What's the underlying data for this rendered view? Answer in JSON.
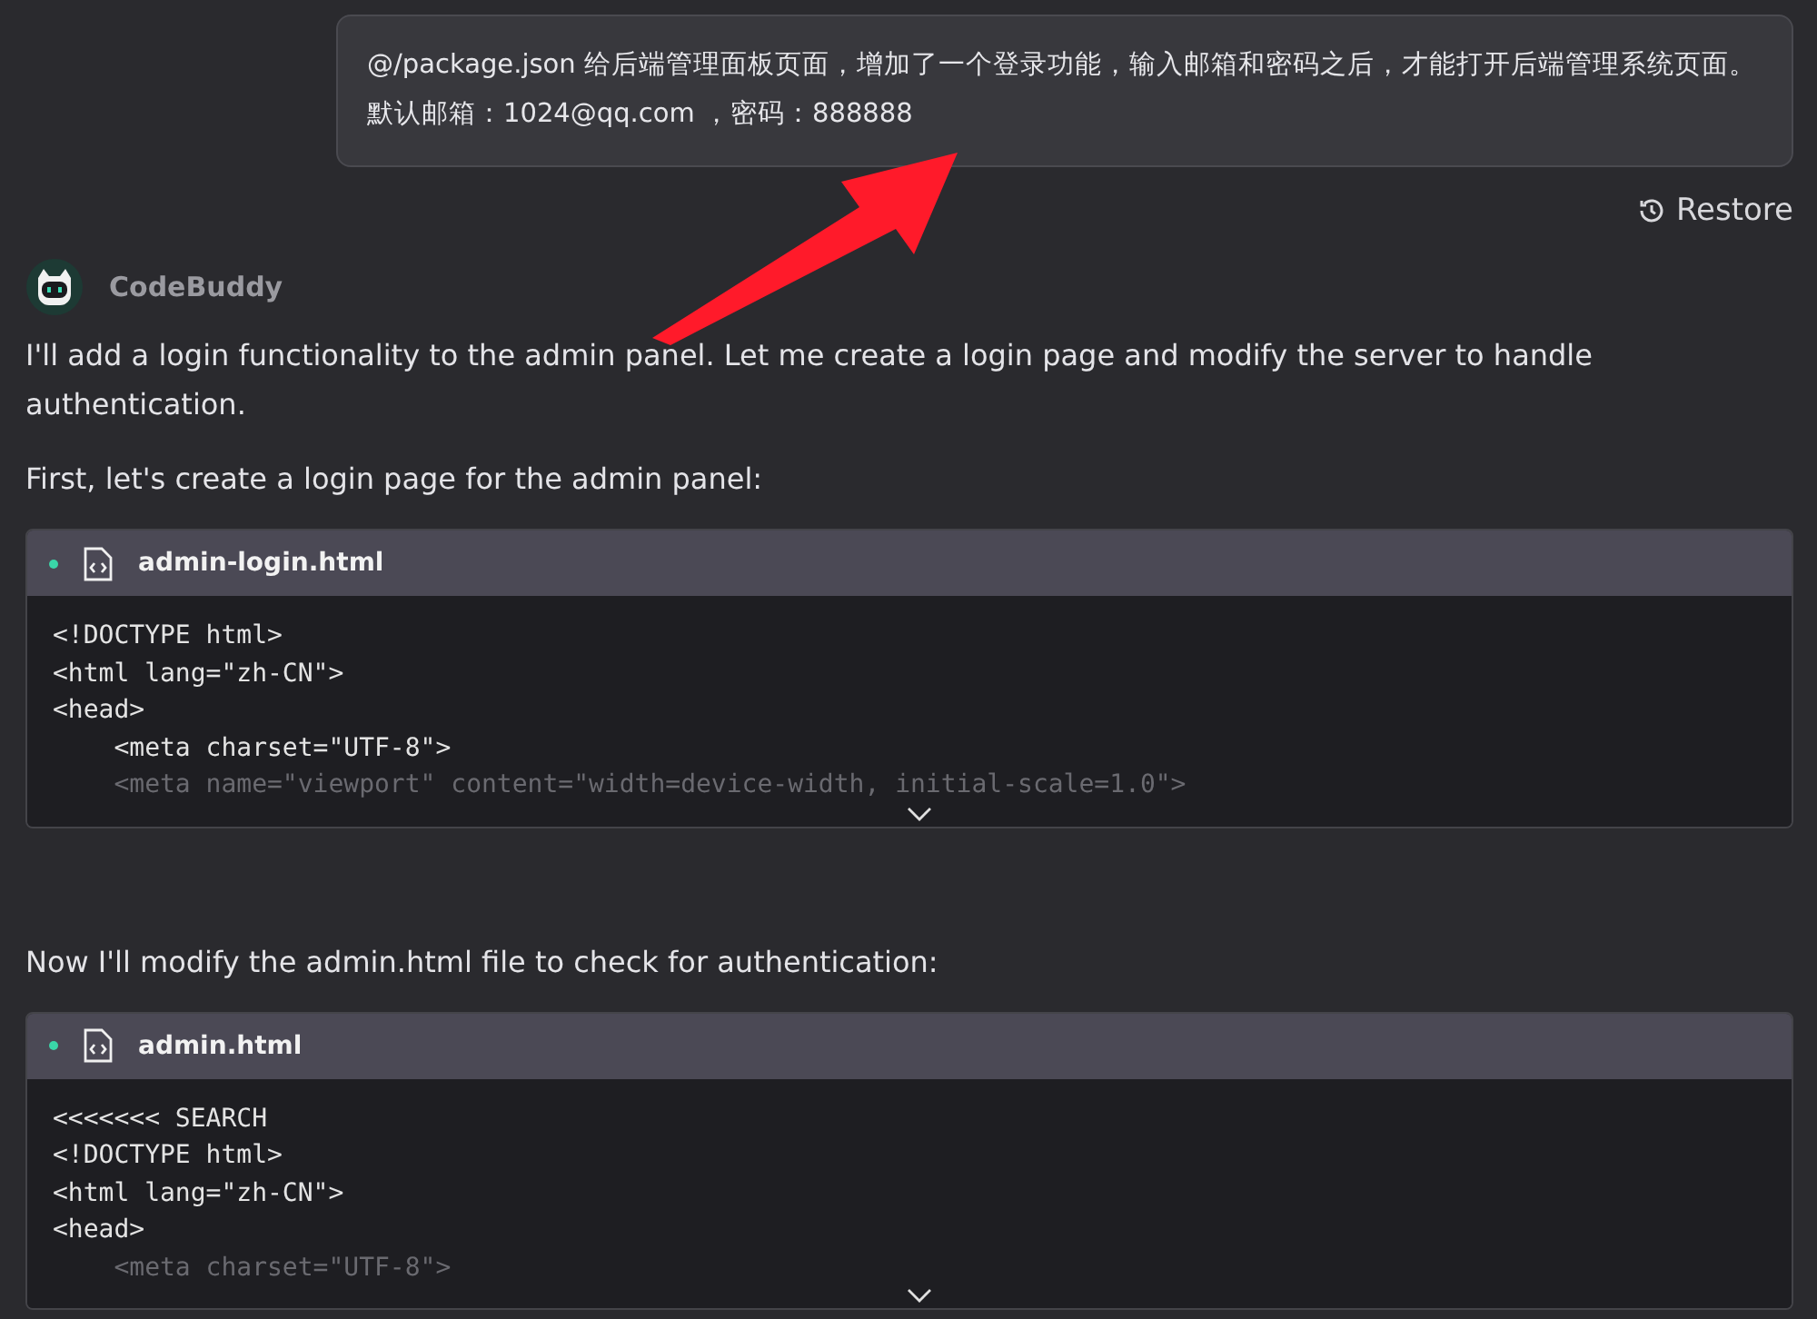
{
  "user_message": {
    "text": "@/package.json 给后端管理面板页面，增加了一个登录功能，输入邮箱和密码之后，才能打开后端管理系统页面。默认邮箱：1024@qq.com ，密码：888888"
  },
  "restore_button": {
    "label": "Restore"
  },
  "assistant": {
    "name": "CodeBuddy"
  },
  "blocks": [
    {
      "kind": "text",
      "text": "I'll add a login functionality to the admin panel. Let me create a login page and modify the server to handle authentication."
    },
    {
      "kind": "text",
      "text": "First, let's create a login page for the admin panel:"
    },
    {
      "kind": "code",
      "filename": "admin-login.html",
      "lines": [
        {
          "text": "<!DOCTYPE html>",
          "faded": false
        },
        {
          "text": "<html lang=\"zh-CN\">",
          "faded": false
        },
        {
          "text": "<head>",
          "faded": false
        },
        {
          "text": "    <meta charset=\"UTF-8\">",
          "faded": false
        },
        {
          "text": "    <meta name=\"viewport\" content=\"width=device-width, initial-scale=1.0\">",
          "faded": true
        }
      ]
    },
    {
      "kind": "text",
      "text": "Now I'll modify the admin.html file to check for authentication:"
    },
    {
      "kind": "code",
      "filename": "admin.html",
      "lines": [
        {
          "text": "<<<<<<< SEARCH",
          "faded": false
        },
        {
          "text": "<!DOCTYPE html>",
          "faded": false
        },
        {
          "text": "<html lang=\"zh-CN\">",
          "faded": false
        },
        {
          "text": "<head>",
          "faded": false
        },
        {
          "text": "    <meta charset=\"UTF-8\">",
          "faded": true
        }
      ]
    }
  ]
}
